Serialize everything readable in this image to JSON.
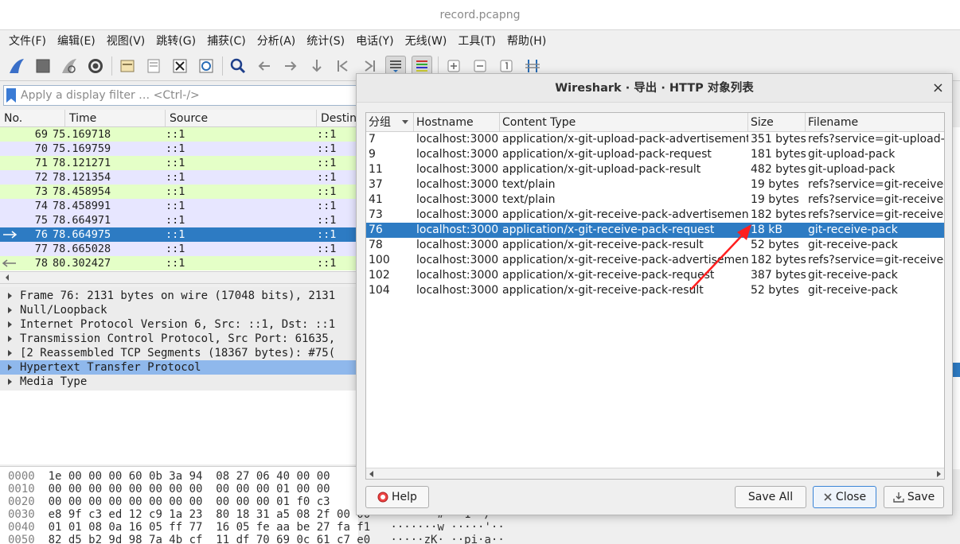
{
  "window": {
    "title": "record.pcapng"
  },
  "menu": [
    "文件(F)",
    "编辑(E)",
    "视图(V)",
    "跳转(G)",
    "捕获(C)",
    "分析(A)",
    "统计(S)",
    "电话(Y)",
    "无线(W)",
    "工具(T)",
    "帮助(H)"
  ],
  "toolbar_icons": [
    "shark-fin-start-icon",
    "stop-square-icon",
    "restart-fin-icon",
    "options-gear-icon",
    "open-folder-icon",
    "save-file-icon",
    "close-file-icon",
    "reload-icon",
    "find-magnifier-icon",
    "back-arrow-icon",
    "forward-arrow-icon",
    "goto-packet-icon",
    "first-packet-icon",
    "last-packet-icon",
    "autoscroll-icon",
    "colorize-icon",
    "zoom-in-icon",
    "zoom-out-icon",
    "normal-size-icon",
    "resize-columns-icon"
  ],
  "filter": {
    "placeholder": "Apply a display filter … <Ctrl-/>"
  },
  "packet_list": {
    "columns": [
      "No.",
      "Time",
      "Source",
      "Destina"
    ],
    "rows": [
      {
        "no": "69",
        "time": "75.169718",
        "src": "::1",
        "dst": "::1",
        "color": "green"
      },
      {
        "no": "70",
        "time": "75.169759",
        "src": "::1",
        "dst": "::1",
        "color": "blue"
      },
      {
        "no": "71",
        "time": "78.121271",
        "src": "::1",
        "dst": "::1",
        "color": "green"
      },
      {
        "no": "72",
        "time": "78.121354",
        "src": "::1",
        "dst": "::1",
        "color": "blue"
      },
      {
        "no": "73",
        "time": "78.458954",
        "src": "::1",
        "dst": "::1",
        "color": "green"
      },
      {
        "no": "74",
        "time": "78.458991",
        "src": "::1",
        "dst": "::1",
        "color": "blue"
      },
      {
        "no": "75",
        "time": "78.664971",
        "src": "::1",
        "dst": "::1",
        "color": "blue"
      },
      {
        "no": "76",
        "time": "78.664975",
        "src": "::1",
        "dst": "::1",
        "color": "sel"
      },
      {
        "no": "77",
        "time": "78.665028",
        "src": "::1",
        "dst": "::1",
        "color": "blue"
      },
      {
        "no": "78",
        "time": "80.302427",
        "src": "::1",
        "dst": "::1",
        "color": "green"
      }
    ]
  },
  "details": [
    "Frame 76: 2131 bytes on wire (17048 bits), 2131",
    "Null/Loopback",
    "Internet Protocol Version 6, Src: ::1, Dst: ::1",
    "Transmission Control Protocol, Src Port: 61635,",
    "[2 Reassembled TCP Segments (18367 bytes): #75(",
    "Hypertext Transfer Protocol",
    "Media Type"
  ],
  "bytes": [
    {
      "off": "0000",
      "hex": "1e 00 00 00 60 0b 3a 94  08 27 06 40 00 00",
      "ascii": ""
    },
    {
      "off": "0010",
      "hex": "00 00 00 00 00 00 00 00  00 00 00 01 00 00",
      "ascii": ""
    },
    {
      "off": "0020",
      "hex": "00 00 00 00 00 00 00 00  00 00 00 01 f0 c3",
      "ascii": ""
    },
    {
      "off": "0030",
      "hex": "e8 9f c3 ed 12 c9 1a 23  80 18 31 a5 08 2f 00 00",
      "ascii": "·······# ··1··/··"
    },
    {
      "off": "0040",
      "hex": "01 01 08 0a 16 05 ff 77  16 05 fe aa be 27 fa f1",
      "ascii": "·······w ·····'··"
    },
    {
      "off": "0050",
      "hex": "82 d5 b2 9d 98 7a 4b cf  11 df 70 69 0c 61 c7 e0",
      "ascii": "·····zK· ··pi·a··"
    }
  ],
  "dialog": {
    "title": "Wireshark · 导出 · HTTP 对象列表",
    "close": "×",
    "columns": [
      "分组",
      "Hostname",
      "Content Type",
      "Size",
      "Filename"
    ],
    "rows": [
      {
        "pkt": "7",
        "host": "localhost:3000",
        "type": "application/x-git-upload-pack-advertisement",
        "size": "351 bytes",
        "file": "refs?service=git-upload-pack"
      },
      {
        "pkt": "9",
        "host": "localhost:3000",
        "type": "application/x-git-upload-pack-request",
        "size": "181 bytes",
        "file": "git-upload-pack"
      },
      {
        "pkt": "11",
        "host": "localhost:3000",
        "type": "application/x-git-upload-pack-result",
        "size": "482 bytes",
        "file": "git-upload-pack"
      },
      {
        "pkt": "37",
        "host": "localhost:3000",
        "type": "text/plain",
        "size": "19 bytes",
        "file": "refs?service=git-receive-pack"
      },
      {
        "pkt": "41",
        "host": "localhost:3000",
        "type": "text/plain",
        "size": "19 bytes",
        "file": "refs?service=git-receive-pack"
      },
      {
        "pkt": "73",
        "host": "localhost:3000",
        "type": "application/x-git-receive-pack-advertisement",
        "size": "182 bytes",
        "file": "refs?service=git-receive-pack"
      },
      {
        "pkt": "76",
        "host": "localhost:3000",
        "type": "application/x-git-receive-pack-request",
        "size": "18 kB",
        "file": "git-receive-pack",
        "selected": true
      },
      {
        "pkt": "78",
        "host": "localhost:3000",
        "type": "application/x-git-receive-pack-result",
        "size": "52 bytes",
        "file": "git-receive-pack"
      },
      {
        "pkt": "100",
        "host": "localhost:3000",
        "type": "application/x-git-receive-pack-advertisement",
        "size": "182 bytes",
        "file": "refs?service=git-receive-pack"
      },
      {
        "pkt": "102",
        "host": "localhost:3000",
        "type": "application/x-git-receive-pack-request",
        "size": "387 bytes",
        "file": "git-receive-pack"
      },
      {
        "pkt": "104",
        "host": "localhost:3000",
        "type": "application/x-git-receive-pack-result",
        "size": "52 bytes",
        "file": "git-receive-pack"
      }
    ],
    "buttons": {
      "help": "Help",
      "save_all": "Save All",
      "close": "Close",
      "save": "Save"
    }
  },
  "annotation": {
    "color": "#ff1e1e"
  }
}
